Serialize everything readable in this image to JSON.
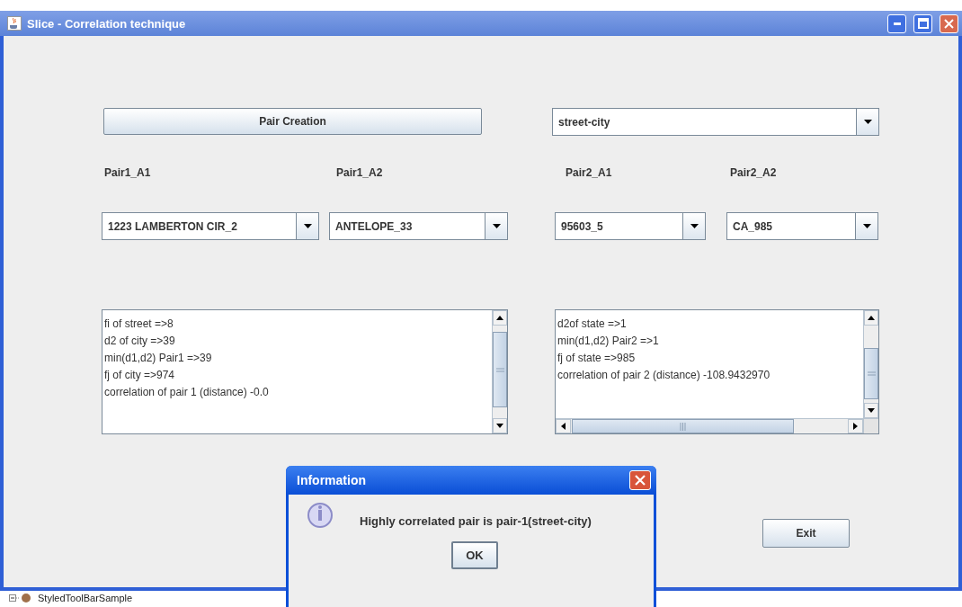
{
  "window": {
    "title": "Slice - Correlation technique"
  },
  "pair_creation_button": {
    "label": "Pair Creation"
  },
  "pair_type_combo": {
    "value": "street-city"
  },
  "pairs": [
    {
      "label": "Pair1_A1",
      "value": "1223 LAMBERTON CIR_2"
    },
    {
      "label": "Pair1_A2",
      "value": "ANTELOPE_33"
    },
    {
      "label": "Pair2_A1",
      "value": "95603_5"
    },
    {
      "label": "Pair2_A2",
      "value": "CA_985"
    }
  ],
  "output_areas": [
    {
      "lines": [
        "fi of street =>8",
        "d2 of city =>39",
        "min(d1,d2) Pair1 =>39",
        "fj of city =>974",
        "correlation of pair 1 (distance) -0.0"
      ],
      "horizontal_scrollbar": false
    },
    {
      "lines": [
        "d2of state =>1",
        "min(d1,d2) Pair2 =>1",
        "fj of state =>985",
        "correlation of pair 2 (distance) -108.9432970"
      ],
      "horizontal_scrollbar": true
    }
  ],
  "exit_button": {
    "label": "Exit"
  },
  "dialog": {
    "title": "Information",
    "message": "Highly correlated pair is pair-1(street-city)",
    "button": "OK"
  },
  "taskbar_item": {
    "label": "StyledToolBarSample"
  }
}
